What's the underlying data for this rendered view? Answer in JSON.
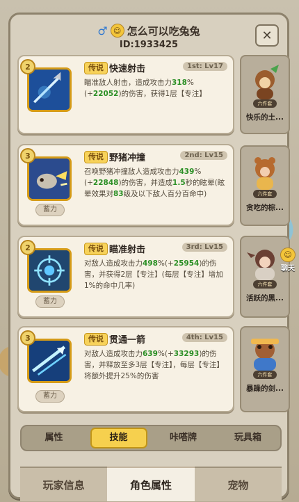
{
  "header": {
    "gender_symbol": "♂",
    "face": "☺",
    "player_name": "怎么可以吃兔兔",
    "player_id": "ID:1933425",
    "close_glyph": "✕"
  },
  "skills": [
    {
      "level_badge": "2",
      "tag": "传说",
      "name": "快速射击",
      "level": "1st: Lv17",
      "desc_prefix": "瞄准敌人射击，造成攻击力",
      "desc_highlight1": "318",
      "desc_mid1": "%(+",
      "desc_highlight2": "22052",
      "desc_suffix": ")的伤害，获得1层【专注】",
      "accumulate_label": ""
    },
    {
      "level_badge": "3",
      "tag": "传说",
      "name": "野猪冲撞",
      "level": "2nd: Lv15",
      "desc_prefix": "召唤野猪冲撞敌人造成攻击力",
      "desc_highlight1": "439",
      "desc_mid1": "%(+",
      "desc_highlight2": "22848",
      "desc_mid2": ")的伤害，并造成",
      "desc_highlight3": "1.5",
      "desc_suffix": "秒的眩晕(眩晕效果对",
      "desc_highlight4": "83",
      "desc_suffix2": "级及以下敌人百分百命中)",
      "accumulate_label": "蓄力"
    },
    {
      "level_badge": "2",
      "tag": "传说",
      "name": "瞄准射击",
      "level": "3rd: Lv15",
      "desc_prefix": "对敌人造成攻击力",
      "desc_highlight1": "498",
      "desc_mid1": "%(+",
      "desc_highlight2": "25954",
      "desc_suffix": ")的伤害，并获得2层【专注】(每层【专注】增加1%的命中几率)",
      "accumulate_label": "蓄力"
    },
    {
      "level_badge": "3",
      "tag": "传说",
      "name": "贯通一箭",
      "level": "4th: Lv15",
      "desc_prefix": "对敌人造成攻击力",
      "desc_highlight1": "639",
      "desc_mid1": "%(+",
      "desc_highlight2": "33293",
      "desc_suffix": ")的伤害，并释放至多3层【专注】，每层【专注】将额外提升25%的伤害",
      "accumulate_label": "蓄力"
    }
  ],
  "pets": [
    {
      "name": "快乐的土...",
      "badge": "六件套"
    },
    {
      "name": "贪吃的棕...",
      "badge": "六件套"
    },
    {
      "name": "活跃的黑...",
      "badge": "六件套"
    },
    {
      "name": "暴躁的剑...",
      "badge": "六件套"
    }
  ],
  "side_chat": {
    "icon": "☺",
    "label": "聊天"
  },
  "subtabs": [
    "属性",
    "技能",
    "咔嗒牌",
    "玩具箱"
  ],
  "bottom_tabs": [
    "玩家信息",
    "角色属性",
    "宠物"
  ]
}
